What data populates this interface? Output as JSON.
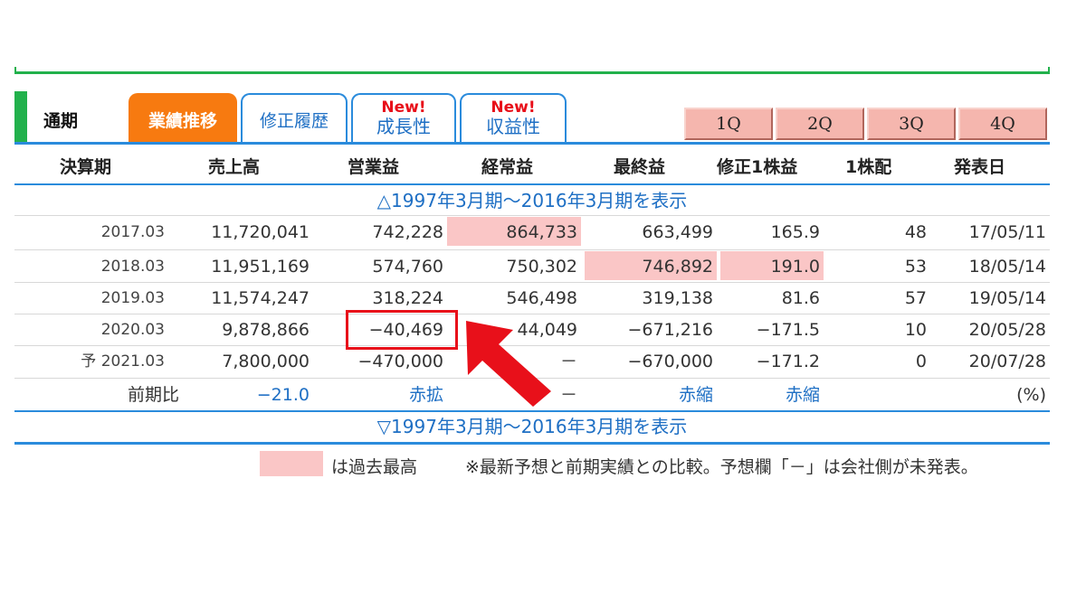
{
  "tabs": {
    "static_label": "通期",
    "active": "業績推移",
    "revision": "修正履歴",
    "growth": {
      "badge": "New!",
      "label": "成長性"
    },
    "profit": {
      "badge": "New!",
      "label": "収益性"
    },
    "quarters": [
      "1Q",
      "2Q",
      "3Q",
      "4Q"
    ]
  },
  "columns": [
    "決算期",
    "売上高",
    "営業益",
    "経常益",
    "最終益",
    "修正1株益",
    "1株配",
    "発表日"
  ],
  "toggle_show": "△1997年3月期～2016年3月期を表示",
  "toggle_hide": "▽1997年3月期～2016年3月期を表示",
  "rows": [
    {
      "period": "2017.03",
      "sales": "11,720,041",
      "op": "742,228",
      "ordinary": "864,733",
      "net": "663,499",
      "eps": "165.9",
      "div": "48",
      "date": "17/05/11"
    },
    {
      "period": "2018.03",
      "sales": "11,951,169",
      "op": "574,760",
      "ordinary": "750,302",
      "net": "746,892",
      "eps": "191.0",
      "div": "53",
      "date": "18/05/14"
    },
    {
      "period": "2019.03",
      "sales": "11,574,247",
      "op": "318,224",
      "ordinary": "546,498",
      "net": "319,138",
      "eps": "81.6",
      "div": "57",
      "date": "19/05/14"
    },
    {
      "period": "2020.03",
      "sales": "9,878,866",
      "op": "−40,469",
      "ordinary": "44,049",
      "net": "−671,216",
      "eps": "−171.5",
      "div": "10",
      "date": "20/05/28"
    },
    {
      "period": "予 2021.03",
      "sales": "7,800,000",
      "op": "−470,000",
      "ordinary": "－",
      "net": "−670,000",
      "eps": "−171.2",
      "div": "0",
      "date": "20/07/28"
    }
  ],
  "yoy": {
    "label": "前期比",
    "sales": "−21.0",
    "op": "赤拡",
    "ordinary": "－",
    "net": "赤縮",
    "eps": "赤縮",
    "unit": "(%)"
  },
  "legend": {
    "text": "は過去最高",
    "note": "※最新予想と前期実績との比較。予想欄「－」は会社側が未発表。"
  },
  "colors": {
    "accent_green": "#22b14c",
    "accent_blue": "#2a8bdc",
    "tab_orange": "#f77a10",
    "highlight": "#fac6c6",
    "annotation_red": "#e8101a"
  }
}
